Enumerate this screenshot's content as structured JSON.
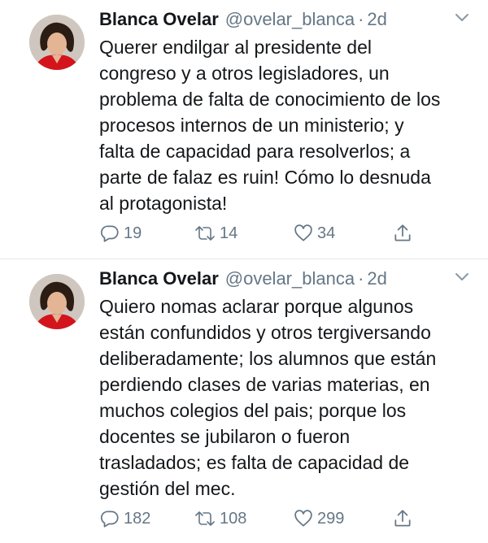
{
  "tweets": [
    {
      "name": "Blanca Ovelar",
      "handle": "@ovelar_blanca",
      "separator": "·",
      "age": "2d",
      "text": "Querer endilgar al presidente del\ncongreso y a otros legisladores, un\nproblema de falta de conocimiento de los\nprocesos internos de un ministerio; y\nfalta de capacidad para resolverlos; a\nparte de falaz es ruin! Cómo lo desnuda\nal protagonista!",
      "replies": "19",
      "retweets": "14",
      "likes": "34"
    },
    {
      "name": "Blanca Ovelar",
      "handle": "@ovelar_blanca",
      "separator": "·",
      "age": "2d",
      "text": "Quiero nomas aclarar porque algunos\nestán confundidos y otros tergiversando\ndeliberadamente; los alumnos que están\nperdiendo clases de varias materias, en\nmuchos colegios del pais; porque los\ndocentes se jubilaron o fueron\ntrasladados; es falta de capacidad de\ngestión del mec.",
      "replies": "182",
      "retweets": "108",
      "likes": "299"
    }
  ],
  "icons": {
    "reply": "reply-icon",
    "retweet": "retweet-icon",
    "like": "heart-icon",
    "share": "share-icon",
    "menu": "chevron-down-icon"
  },
  "colors": {
    "icon": "#657786",
    "divider": "#e1e8ed",
    "text": "#14171a"
  }
}
